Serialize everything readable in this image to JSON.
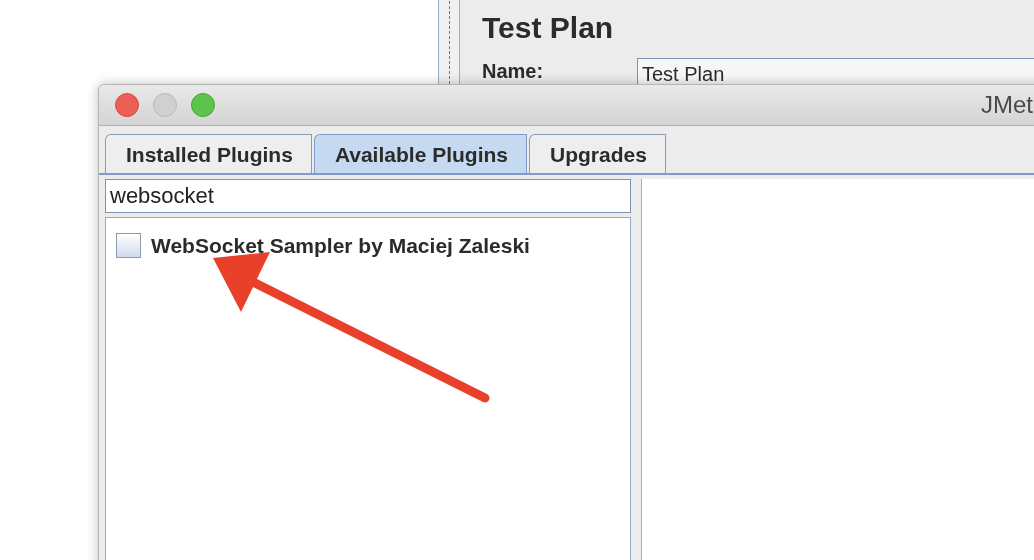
{
  "background_window": {
    "heading": "Test Plan",
    "name_label": "Name:",
    "name_value": "Test Plan"
  },
  "window": {
    "title": "JMet",
    "tabs": [
      {
        "label": "Installed Plugins",
        "selected": false
      },
      {
        "label": "Available Plugins",
        "selected": true
      },
      {
        "label": "Upgrades",
        "selected": false
      }
    ],
    "search": {
      "value": "websocket"
    },
    "plugins": [
      {
        "label": "WebSocket Sampler by Maciej Zaleski",
        "checked": false
      }
    ]
  }
}
